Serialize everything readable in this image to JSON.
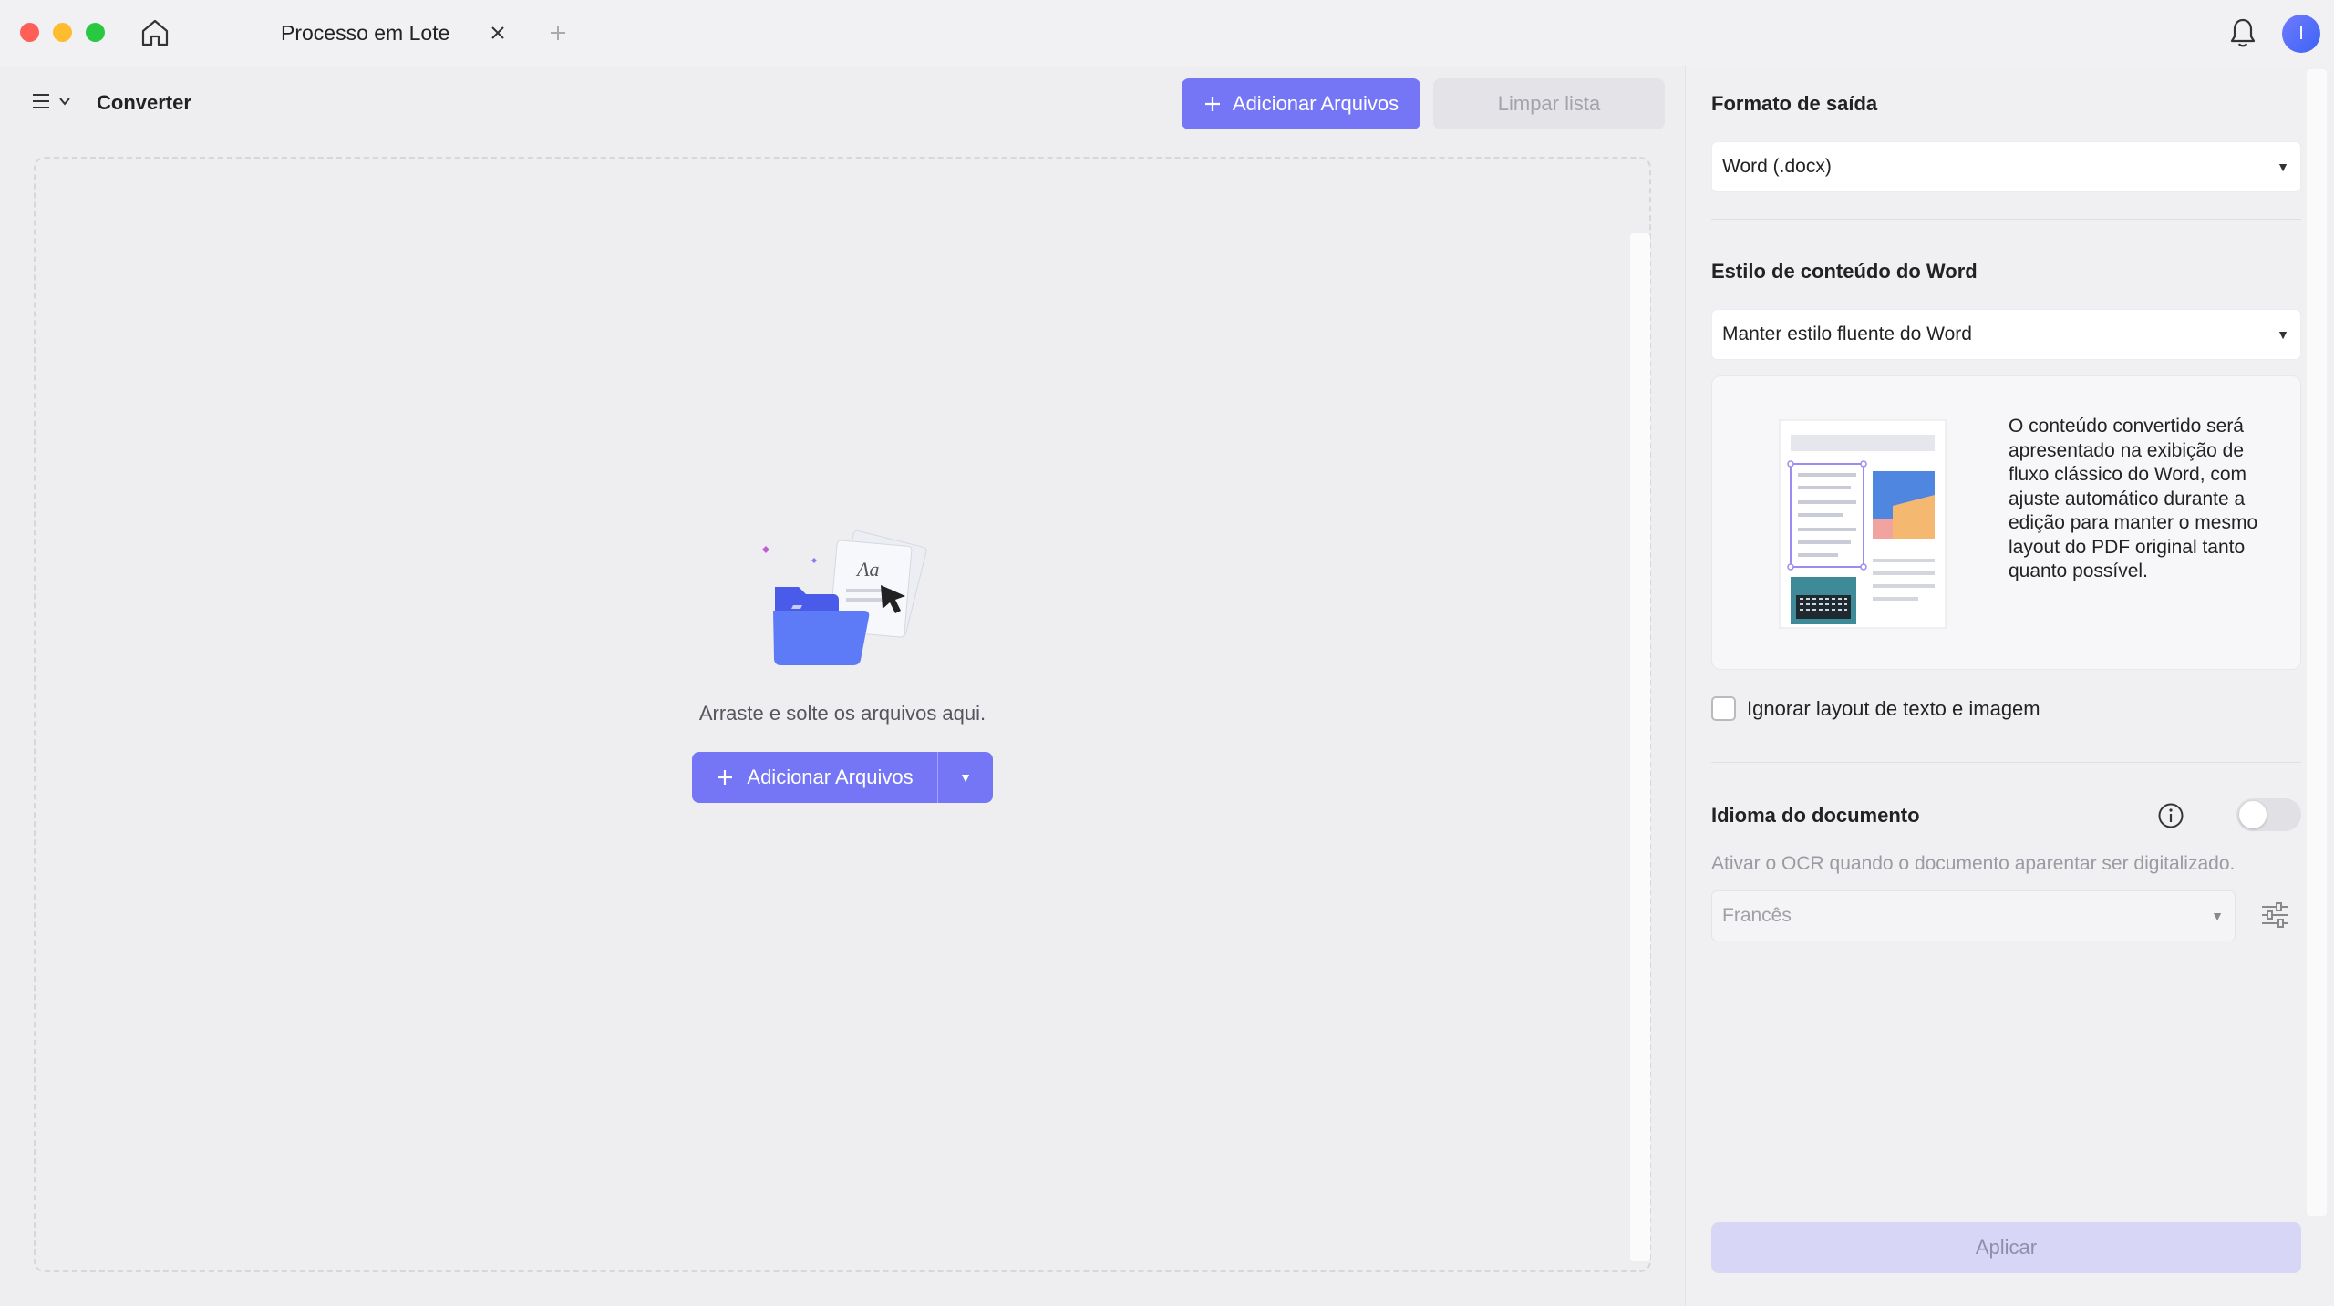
{
  "window": {
    "tab_title": "Processo em Lote",
    "avatar_initial": "I"
  },
  "toolbar": {
    "title": "Converter",
    "add_files_label": "Adicionar Arquivos",
    "clear_list_label": "Limpar lista"
  },
  "dropzone": {
    "message": "Arraste e solte os arquivos aqui.",
    "add_files_label": "Adicionar Arquivos"
  },
  "settings": {
    "output_format_label": "Formato de saída",
    "output_format_value": "Word (.docx)",
    "word_style_label": "Estilo de conteúdo do Word",
    "word_style_value": "Manter estilo fluente do Word",
    "style_description": "O conteúdo convertido será apresentado na exibição de fluxo clássico do Word, com ajuste automático durante a edição para manter o mesmo layout do PDF original tanto quanto possível.",
    "ignore_layout_label": "Ignorar layout de texto e imagem",
    "ignore_layout_checked": false,
    "doc_language_label": "Idioma do documento",
    "ocr_enabled": false,
    "ocr_hint": "Ativar o OCR quando o documento aparentar ser digitalizado.",
    "language_value": "Francês",
    "apply_label": "Aplicar"
  },
  "colors": {
    "accent": "#7476f6",
    "accent_disabled": "#d7d6f6"
  }
}
